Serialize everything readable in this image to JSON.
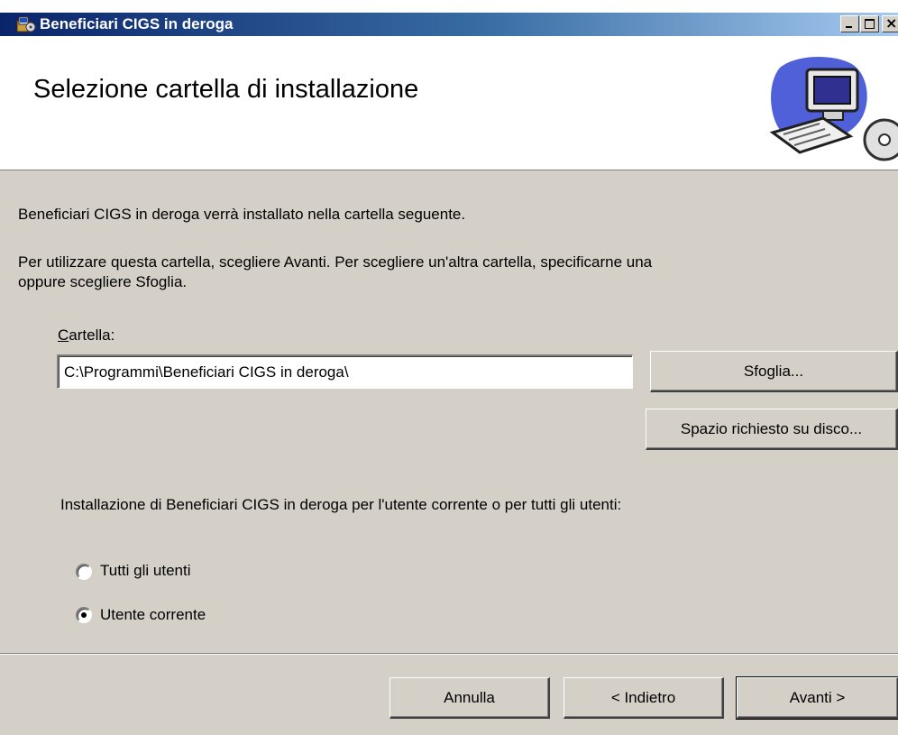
{
  "window": {
    "title": "Beneficiari CIGS in deroga"
  },
  "banner": {
    "title": "Selezione cartella di installazione"
  },
  "content": {
    "intro": "Beneficiari CIGS in deroga verrà installato nella cartella seguente.",
    "instructions_line1": "Per utilizzare questa cartella, scegliere Avanti. Per scegliere un'altra cartella, specificarne una",
    "instructions_line2": "oppure scegliere Sfoglia.",
    "folder_label_mnemonic": "C",
    "folder_label_rest": "artella:",
    "folder_value": "C:\\Programmi\\Beneficiari CIGS in deroga\\",
    "browse_label": "Sfoglia...",
    "disk_space_label": "Spazio richiesto su disco...",
    "install_for_text": "Installazione di Beneficiari CIGS in deroga per l'utente corrente o per tutti gli utenti:",
    "radio_all": "Tutti gli utenti",
    "radio_current": "Utente corrente",
    "selected_option": "Utente corrente"
  },
  "footer": {
    "cancel_label": "Annulla",
    "back_label": "< Indietro",
    "next_label": "Avanti >"
  },
  "icons": {
    "app": "installer-package-icon",
    "banner": "computer-with-cd-icon",
    "minimize": "minimize-icon",
    "maximize": "maximize-icon",
    "close": "close-icon"
  },
  "colors": {
    "titlebar_start": "#0a246a",
    "titlebar_end": "#a6caf0",
    "dialog_bg": "#d4d0c8"
  }
}
